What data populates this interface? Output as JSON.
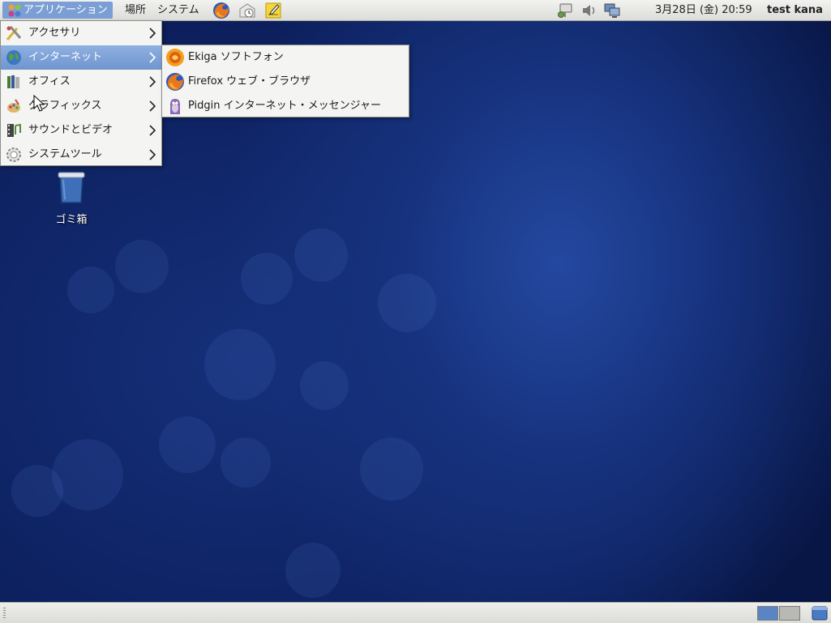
{
  "top_panel": {
    "applications_label": "アプリケーション",
    "places_label": "場所",
    "system_label": "システム",
    "launchers": [
      "firefox-icon",
      "mail-clock-icon",
      "note-edit-icon"
    ],
    "tray_icons": [
      "network-icon",
      "volume-icon",
      "display-icon"
    ],
    "clock": "3月28日 (金) 20:59",
    "user": "test kana"
  },
  "applications_menu": {
    "items": [
      {
        "label": "アクセサリ",
        "icon": "accessories-icon"
      },
      {
        "label": "インターネット",
        "icon": "internet-globe-icon",
        "active": true
      },
      {
        "label": "オフィス",
        "icon": "office-icon"
      },
      {
        "label": "グラフィックス",
        "icon": "graphics-icon"
      },
      {
        "label": "サウンドとビデオ",
        "icon": "sound-video-icon"
      },
      {
        "label": "システムツール",
        "icon": "system-tools-icon"
      }
    ]
  },
  "internet_submenu": {
    "items": [
      {
        "label": "Ekiga ソフトフォン",
        "icon": "ekiga-icon"
      },
      {
        "label": "Firefox ウェブ・ブラウザ",
        "icon": "firefox-icon"
      },
      {
        "label": "Pidgin インターネット・メッセンジャー",
        "icon": "pidgin-icon"
      }
    ]
  },
  "desktop": {
    "trash_label": "ゴミ箱"
  },
  "colors": {
    "panel_bg": "#e6e6e2",
    "menu_highlight": "#7b9fd4",
    "desktop_bg": "#0d1f5c"
  }
}
